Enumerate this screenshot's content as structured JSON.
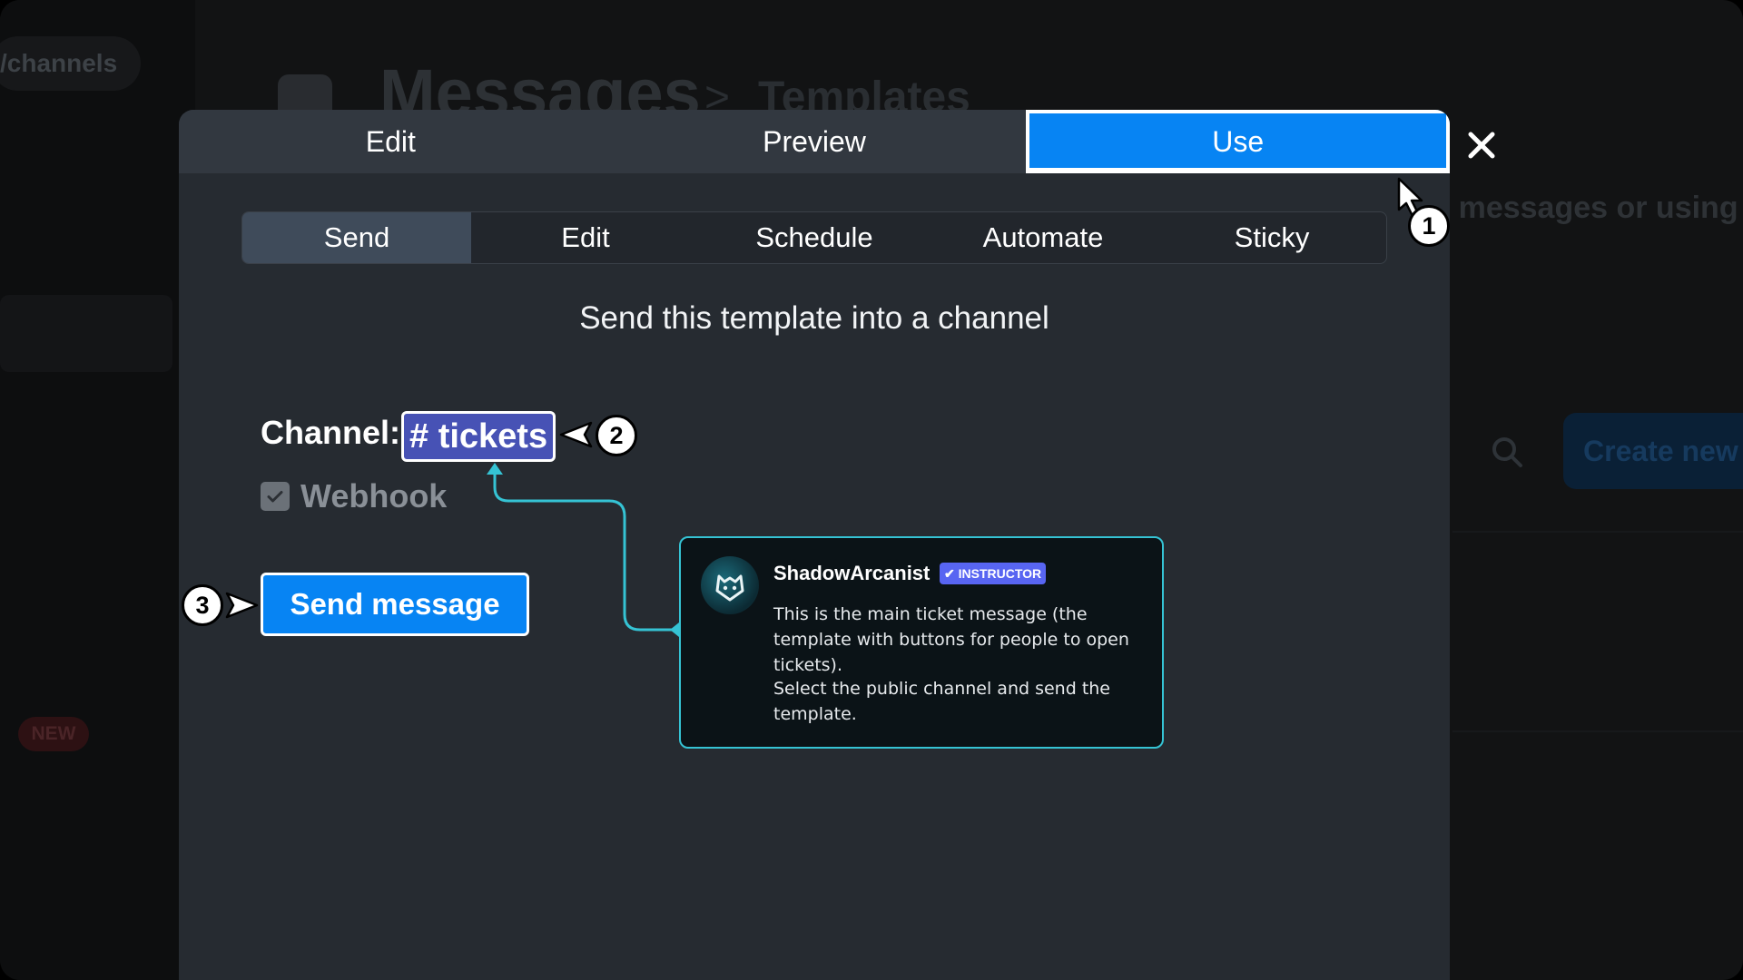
{
  "background": {
    "sidebar_channels": "/channels",
    "new_badge": "NEW",
    "page_title": "Messages",
    "breadcrumb_separator": ">",
    "page_subtitle": "Templates",
    "description_fragment": "er messages or using",
    "create_button": "Create new"
  },
  "modal": {
    "tabs": [
      {
        "label": "Edit"
      },
      {
        "label": "Preview"
      },
      {
        "label": "Use",
        "active": true
      }
    ],
    "subtabs": [
      {
        "label": "Send",
        "active": true
      },
      {
        "label": "Edit"
      },
      {
        "label": "Schedule"
      },
      {
        "label": "Automate"
      },
      {
        "label": "Sticky"
      }
    ],
    "heading": "Send this template into a channel",
    "channel_label": "Channel:",
    "channel_value": "# tickets",
    "webhook_label": "Webhook",
    "webhook_checked": true,
    "send_button": "Send message"
  },
  "callout": {
    "author": "ShadowArcanist",
    "badge": "✔ INSTRUCTOR",
    "paragraph1": "This is the main ticket message (the template with buttons for people to open tickets).",
    "paragraph2": "Select the public channel and send the template."
  },
  "markers": [
    "1",
    "2",
    "3"
  ],
  "colors": {
    "accent": "#0784f3",
    "channel_pill": "#4752b5",
    "callout_border": "#35c3d4",
    "badge": "#5865f2"
  }
}
